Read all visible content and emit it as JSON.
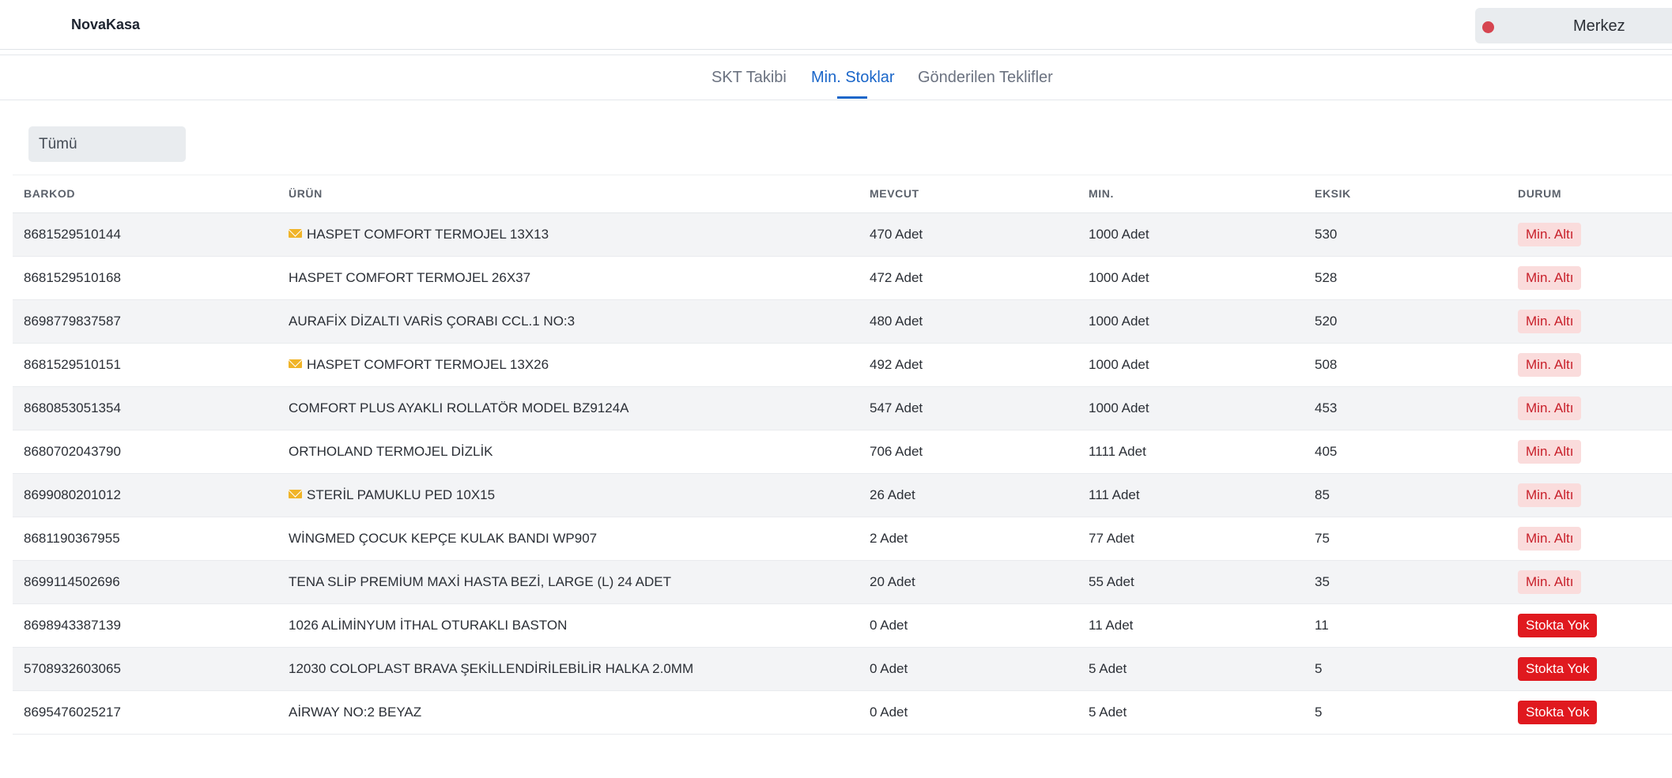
{
  "app": {
    "brand": "NovaKasa",
    "branch": "Merkez",
    "branch_dot_color": "#d64550"
  },
  "tabs": [
    {
      "label": "SKT Takibi",
      "active": false
    },
    {
      "label": "Min. Stoklar",
      "active": true
    },
    {
      "label": "Gönderilen Teklifler",
      "active": false
    }
  ],
  "filter": {
    "value": "Tümü"
  },
  "table": {
    "headers": [
      "BARKOD",
      "ÜRÜN",
      "MEVCUT",
      "MIN.",
      "EKSIK",
      "DURUM"
    ],
    "rows": [
      {
        "barcode": "8681529510144",
        "product": "HASPET COMFORT TERMOJEL 13X13",
        "has_mail_icon": true,
        "current": "470 Adet",
        "min": "1000 Adet",
        "missing": "530",
        "status": "Min. Altı",
        "status_type": "low"
      },
      {
        "barcode": "8681529510168",
        "product": "HASPET COMFORT TERMOJEL 26X37",
        "has_mail_icon": false,
        "current": "472 Adet",
        "min": "1000 Adet",
        "missing": "528",
        "status": "Min. Altı",
        "status_type": "low"
      },
      {
        "barcode": "8698779837587",
        "product": "AURAFİX DİZALTI VARİS ÇORABI CCL.1 NO:3",
        "has_mail_icon": false,
        "current": "480 Adet",
        "min": "1000 Adet",
        "missing": "520",
        "status": "Min. Altı",
        "status_type": "low"
      },
      {
        "barcode": "8681529510151",
        "product": "HASPET COMFORT TERMOJEL 13X26",
        "has_mail_icon": true,
        "current": "492 Adet",
        "min": "1000 Adet",
        "missing": "508",
        "status": "Min. Altı",
        "status_type": "low"
      },
      {
        "barcode": "8680853051354",
        "product": "COMFORT PLUS AYAKLI ROLLATÖR MODEL BZ9124A",
        "has_mail_icon": false,
        "current": "547 Adet",
        "min": "1000 Adet",
        "missing": "453",
        "status": "Min. Altı",
        "status_type": "low"
      },
      {
        "barcode": "8680702043790",
        "product": "ORTHOLAND TERMOJEL DİZLİK",
        "has_mail_icon": false,
        "current": "706 Adet",
        "min": "1111 Adet",
        "missing": "405",
        "status": "Min. Altı",
        "status_type": "low"
      },
      {
        "barcode": "8699080201012",
        "product": "STERİL PAMUKLU PED 10X15",
        "has_mail_icon": true,
        "current": "26 Adet",
        "min": "111 Adet",
        "missing": "85",
        "status": "Min. Altı",
        "status_type": "low"
      },
      {
        "barcode": "8681190367955",
        "product": "WİNGMED ÇOCUK KEPÇE KULAK BANDI WP907",
        "has_mail_icon": false,
        "current": "2 Adet",
        "min": "77 Adet",
        "missing": "75",
        "status": "Min. Altı",
        "status_type": "low"
      },
      {
        "barcode": "8699114502696",
        "product": "TENA SLİP PREMİUM MAXİ HASTA BEZİ, LARGE (L) 24 ADET",
        "has_mail_icon": false,
        "current": "20 Adet",
        "min": "55 Adet",
        "missing": "35",
        "status": "Min. Altı",
        "status_type": "low"
      },
      {
        "barcode": "8698943387139",
        "product": "1026 ALİMİNYUM İTHAL OTURAKLI BASTON",
        "has_mail_icon": false,
        "current": "0 Adet",
        "min": "11 Adet",
        "missing": "11",
        "status": "Stokta Yok",
        "status_type": "out"
      },
      {
        "barcode": "5708932603065",
        "product": "12030 COLOPLAST BRAVA ŞEKİLLENDİRİLEBİLİR HALKA 2.0MM",
        "has_mail_icon": false,
        "current": "0 Adet",
        "min": "5 Adet",
        "missing": "5",
        "status": "Stokta Yok",
        "status_type": "out"
      },
      {
        "barcode": "8695476025217",
        "product": "AİRWAY NO:2 BEYAZ",
        "has_mail_icon": false,
        "current": "0 Adet",
        "min": "5 Adet",
        "missing": "5",
        "status": "Stokta Yok",
        "status_type": "out"
      }
    ]
  },
  "colors": {
    "accent": "#1a66c9",
    "low_bg": "#fadcdc",
    "low_text": "#c8202a",
    "out_bg": "#e0191f",
    "mail_icon": "#f0b429"
  }
}
